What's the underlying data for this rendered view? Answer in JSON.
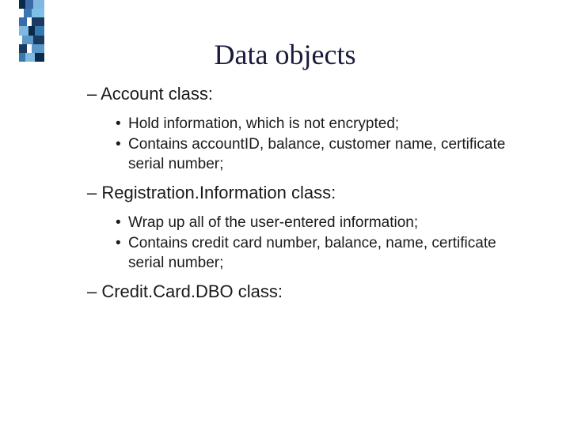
{
  "title": "Data objects",
  "sections": [
    {
      "heading": "– Account class:",
      "bullets": [
        "Hold information, which is not encrypted;",
        "Contains accountID, balance, customer name, certificate serial number;"
      ]
    },
    {
      "heading": "– Registration.Information class:",
      "bullets": [
        "Wrap up all of the user-entered information;",
        "Contains credit card number, balance, name, certificate serial number;"
      ]
    },
    {
      "heading": "– Credit.Card.DBO class:",
      "bullets": []
    }
  ],
  "stripe_rows": [
    [
      {
        "c": "#0a2a4a",
        "w": 8
      },
      {
        "c": "#3a6aa8",
        "w": 10
      },
      {
        "c": "#80b8e0",
        "w": 14
      }
    ],
    [
      {
        "c": "#ffffff",
        "w": 6
      },
      {
        "c": "#3878b0",
        "w": 10
      },
      {
        "c": "#7fc0e8",
        "w": 16
      }
    ],
    [
      {
        "c": "#3a6aa8",
        "w": 10
      },
      {
        "c": "#ffffff",
        "w": 6
      },
      {
        "c": "#1a3a60",
        "w": 16
      }
    ],
    [
      {
        "c": "#80b8e0",
        "w": 12
      },
      {
        "c": "#0a2a4a",
        "w": 8
      },
      {
        "c": "#3878b0",
        "w": 12
      }
    ],
    [
      {
        "c": "#ffffff",
        "w": 4
      },
      {
        "c": "#5a98c8",
        "w": 14
      },
      {
        "c": "#1a3a60",
        "w": 14
      }
    ],
    [
      {
        "c": "#1a3a60",
        "w": 10
      },
      {
        "c": "#ffffff",
        "w": 6
      },
      {
        "c": "#5a98c8",
        "w": 16
      }
    ],
    [
      {
        "c": "#3878b0",
        "w": 8
      },
      {
        "c": "#80b8e0",
        "w": 12
      },
      {
        "c": "#0a2a4a",
        "w": 12
      }
    ]
  ]
}
